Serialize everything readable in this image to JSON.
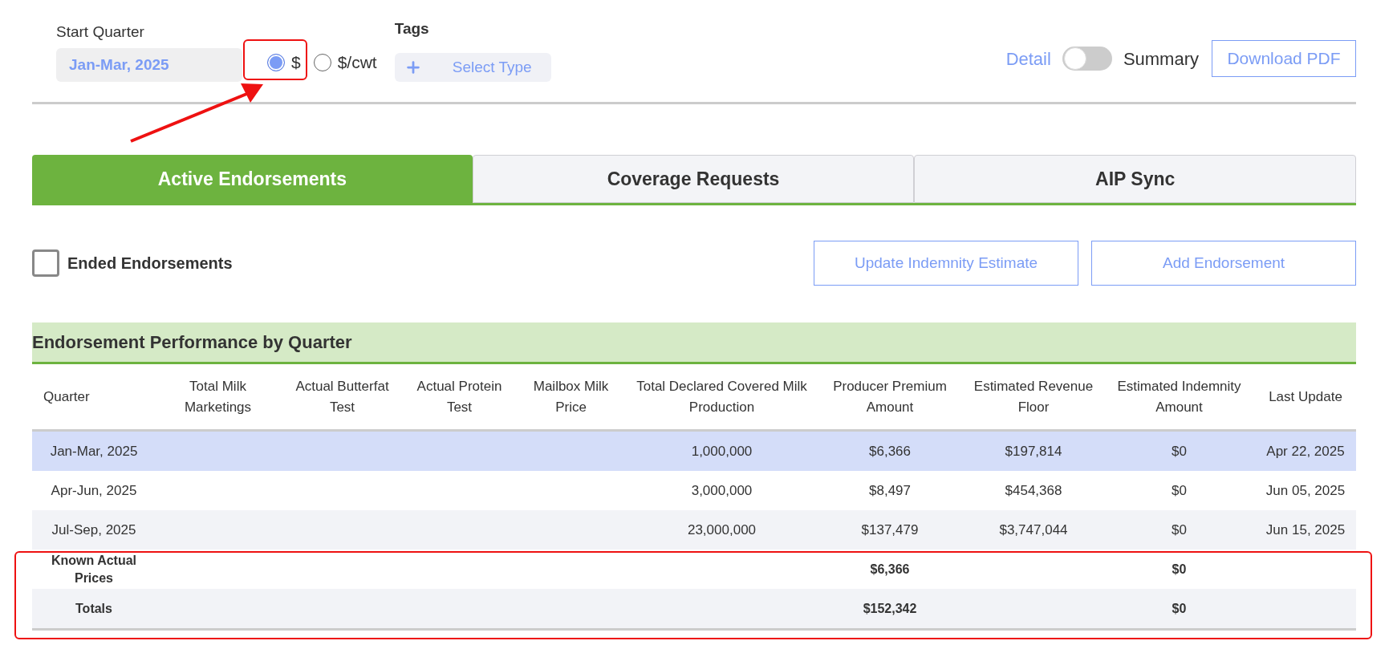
{
  "start_quarter": {
    "label": "Start Quarter",
    "value": "Jan-Mar, 2025"
  },
  "units": [
    {
      "label": "$",
      "selected": true
    },
    {
      "label": "$/cwt",
      "selected": false
    }
  ],
  "tags": {
    "label": "Tags",
    "placeholder": "Select Type"
  },
  "view_toggle": {
    "left": "Detail",
    "right": "Summary",
    "on": false
  },
  "download_button": "Download PDF",
  "tabs": [
    {
      "label": "Active Endorsements",
      "selected": true
    },
    {
      "label": "Coverage Requests",
      "selected": false
    },
    {
      "label": "AIP Sync",
      "selected": false
    }
  ],
  "ended_endorsements": {
    "label": "Ended Endorsements",
    "checked": false
  },
  "actions": [
    "Update Indemnity Estimate",
    "Add Endorsement"
  ],
  "table": {
    "title": "Endorsement Performance by Quarter",
    "columns": [
      "Quarter",
      "Total Milk Marketings",
      "Actual Butterfat Test",
      "Actual Protein Test",
      "Mailbox Milk Price",
      "Total Declared Covered Milk Production",
      "Producer Premium Amount",
      "Estimated Revenue Floor",
      "Estimated Indemnity Amount",
      "Last Update"
    ],
    "rows": [
      {
        "kind": "quarter",
        "selected": true,
        "cells": [
          "Jan-Mar, 2025",
          null,
          null,
          null,
          null,
          "1,000,000",
          "$6,366",
          "$197,814",
          "$0",
          "Apr 22, 2025"
        ]
      },
      {
        "kind": "quarter",
        "selected": false,
        "cells": [
          "Apr-Jun, 2025",
          null,
          null,
          null,
          null,
          "3,000,000",
          "$8,497",
          "$454,368",
          "$0",
          "Jun 05, 2025"
        ]
      },
      {
        "kind": "quarter",
        "selected": false,
        "cells": [
          "Jul-Sep, 2025",
          null,
          null,
          null,
          null,
          "23,000,000",
          "$137,479",
          "$3,747,044",
          "$0",
          "Jun 15, 2025"
        ]
      },
      {
        "kind": "summary",
        "selected": false,
        "cells": [
          "Known Actual Prices",
          null,
          null,
          null,
          null,
          null,
          "$6,366",
          null,
          "$0",
          null
        ]
      },
      {
        "kind": "summary",
        "selected": false,
        "cells": [
          "Totals",
          null,
          null,
          null,
          null,
          null,
          "$152,342",
          null,
          "$0",
          null
        ]
      }
    ]
  }
}
